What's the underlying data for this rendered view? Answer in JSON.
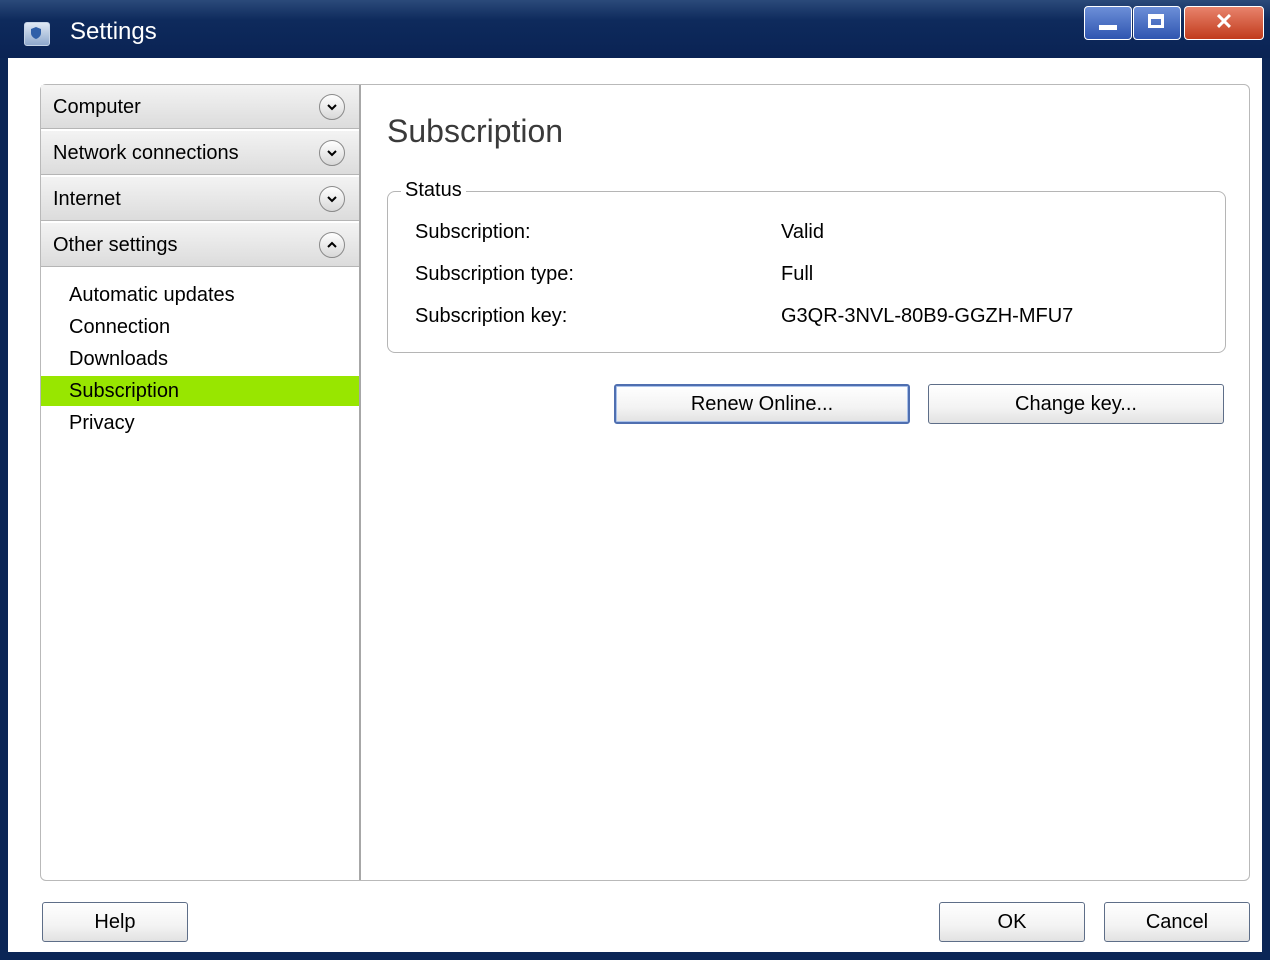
{
  "window": {
    "title": "Settings"
  },
  "nav": {
    "sections": [
      {
        "label": "Computer",
        "expanded": false
      },
      {
        "label": "Network connections",
        "expanded": false
      },
      {
        "label": "Internet",
        "expanded": false
      },
      {
        "label": "Other settings",
        "expanded": true
      }
    ],
    "subitems": [
      {
        "label": "Automatic updates"
      },
      {
        "label": "Connection"
      },
      {
        "label": "Downloads"
      },
      {
        "label": "Subscription",
        "selected": true
      },
      {
        "label": "Privacy"
      }
    ],
    "selected_color": "#98e600"
  },
  "content": {
    "title": "Subscription",
    "status_group": {
      "legend": "Status",
      "rows": [
        {
          "label": "Subscription:",
          "value": "Valid"
        },
        {
          "label": "Subscription type:",
          "value": "Full"
        },
        {
          "label": "Subscription key:",
          "value": "G3QR-3NVL-80B9-GGZH-MFU7"
        }
      ]
    },
    "buttons": {
      "renew": "Renew Online...",
      "change_key": "Change key..."
    }
  },
  "footer": {
    "help": "Help",
    "ok": "OK",
    "cancel": "Cancel"
  }
}
